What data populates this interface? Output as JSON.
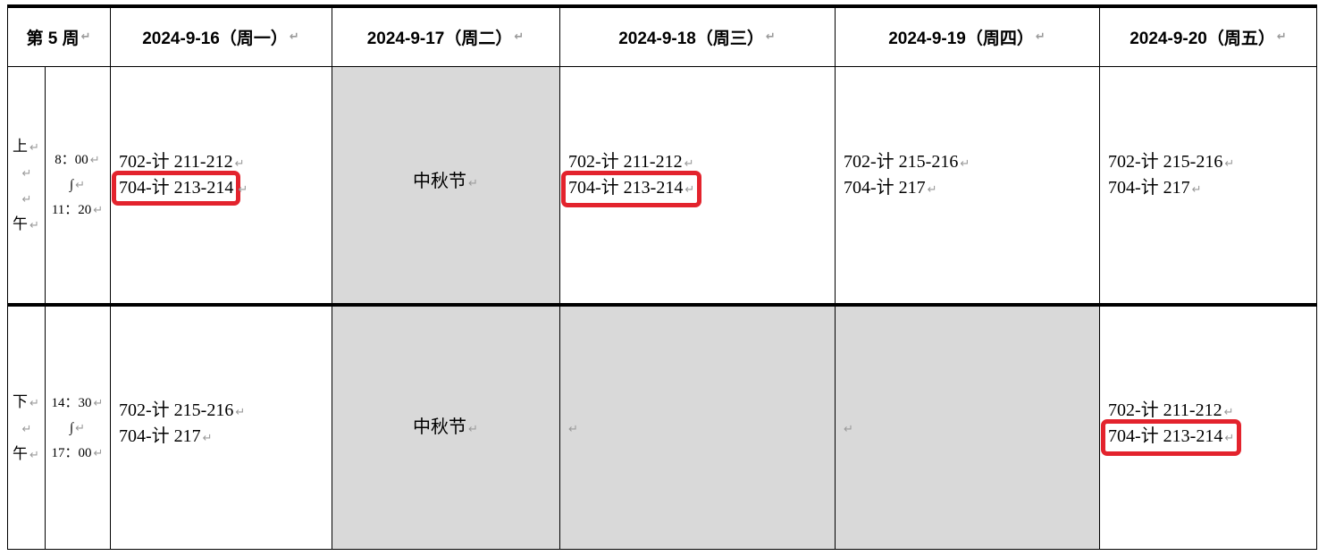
{
  "header": {
    "week_label": "第 5 周",
    "days": [
      "2024-9-16（周一）",
      "2024-9-17（周二）",
      "2024-9-18（周三）",
      "2024-9-19（周四）",
      "2024-9-20（周五）"
    ]
  },
  "morning": {
    "period_chars": [
      "上",
      "",
      "",
      "午"
    ],
    "times": [
      "8：00",
      "∫",
      "11：20"
    ],
    "cells": [
      {
        "lines": [
          {
            "text": "702-计 211-212",
            "highlighted": false
          },
          {
            "text": "704-计 213-214",
            "highlighted": true
          }
        ]
      },
      {
        "holiday": "中秋节"
      },
      {
        "lines": [
          {
            "text": "702-计 211-212",
            "highlighted": false
          },
          {
            "text": "704-计 213-214",
            "highlighted": true
          }
        ]
      },
      {
        "lines": [
          {
            "text": "702-计 215-216",
            "highlighted": false
          },
          {
            "text": "704-计 217",
            "highlighted": false
          }
        ]
      },
      {
        "lines": [
          {
            "text": "702-计 215-216",
            "highlighted": false
          },
          {
            "text": "704-计 217",
            "highlighted": false
          }
        ]
      }
    ]
  },
  "afternoon": {
    "period_chars": [
      "下",
      "",
      "午"
    ],
    "times": [
      "14：30",
      "∫",
      "17：00"
    ],
    "cells": [
      {
        "lines": [
          {
            "text": "702-计 215-216",
            "highlighted": false
          },
          {
            "text": "704-计 217",
            "highlighted": false
          }
        ]
      },
      {
        "holiday": "中秋节"
      },
      {
        "empty": true
      },
      {
        "empty": true
      },
      {
        "lines": [
          {
            "text": "702-计 211-212",
            "highlighted": false
          },
          {
            "text": "704-计 213-214",
            "highlighted": true
          }
        ]
      }
    ]
  },
  "colors": {
    "highlight_border": "#e3232d",
    "shade": "#d9d9d9",
    "paragraph_mark": "#9a9a9a"
  },
  "paragraph_mark": "↵"
}
